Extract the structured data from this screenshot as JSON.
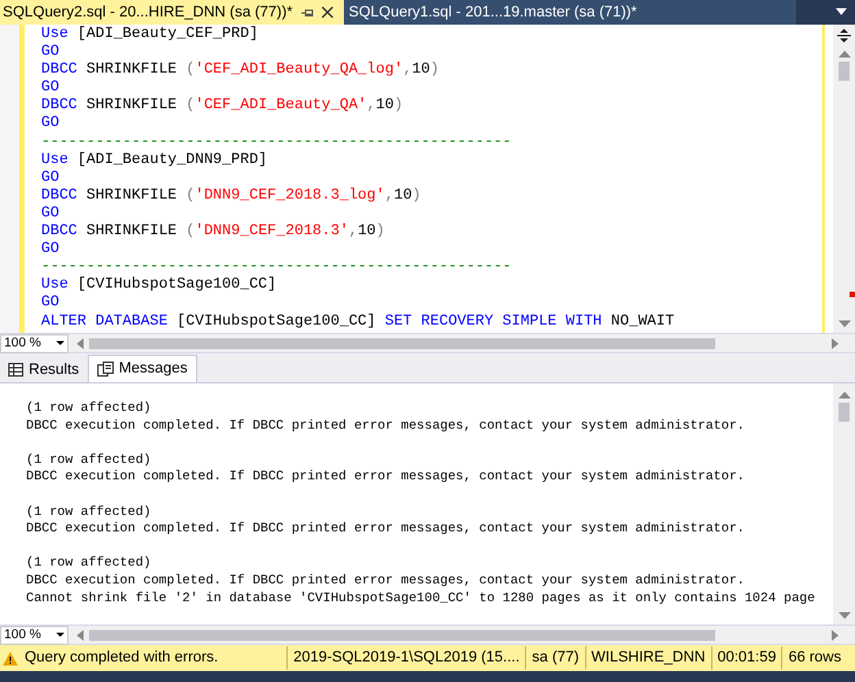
{
  "tabs": [
    {
      "label": "SQLQuery2.sql - 20...HIRE_DNN (sa (77))*",
      "selected": true
    },
    {
      "label": "SQLQuery1.sql - 201...19.master (sa (71))*",
      "selected": false
    }
  ],
  "editor": {
    "lines": [
      [
        {
          "kind": "keyword",
          "text": "Use"
        },
        {
          "kind": "plain",
          "text": " [ADI_Beauty_CEF_PRD]"
        }
      ],
      [
        {
          "kind": "keyword",
          "text": "GO"
        }
      ],
      [
        {
          "kind": "keyword",
          "text": "DBCC"
        },
        {
          "kind": "plain",
          "text": " SHRINKFILE "
        },
        {
          "kind": "punct",
          "text": "("
        },
        {
          "kind": "string",
          "text": "'CEF_ADI_Beauty_QA_log'"
        },
        {
          "kind": "punct",
          "text": ","
        },
        {
          "kind": "plain",
          "text": "10"
        },
        {
          "kind": "punct",
          "text": ")"
        }
      ],
      [
        {
          "kind": "keyword",
          "text": "GO"
        }
      ],
      [
        {
          "kind": "keyword",
          "text": "DBCC"
        },
        {
          "kind": "plain",
          "text": " SHRINKFILE "
        },
        {
          "kind": "punct",
          "text": "("
        },
        {
          "kind": "string",
          "text": "'CEF_ADI_Beauty_QA'"
        },
        {
          "kind": "punct",
          "text": ","
        },
        {
          "kind": "plain",
          "text": "10"
        },
        {
          "kind": "punct",
          "text": ")"
        }
      ],
      [
        {
          "kind": "keyword",
          "text": "GO"
        }
      ],
      [
        {
          "kind": "comment",
          "text": "----------------------------------------------------"
        }
      ],
      [
        {
          "kind": "keyword",
          "text": "Use"
        },
        {
          "kind": "plain",
          "text": " [ADI_Beauty_DNN9_PRD]"
        }
      ],
      [
        {
          "kind": "keyword",
          "text": "GO"
        }
      ],
      [
        {
          "kind": "keyword",
          "text": "DBCC"
        },
        {
          "kind": "plain",
          "text": " SHRINKFILE "
        },
        {
          "kind": "punct",
          "text": "("
        },
        {
          "kind": "string",
          "text": "'DNN9_CEF_2018.3_log'"
        },
        {
          "kind": "punct",
          "text": ","
        },
        {
          "kind": "plain",
          "text": "10"
        },
        {
          "kind": "punct",
          "text": ")"
        }
      ],
      [
        {
          "kind": "keyword",
          "text": "GO"
        }
      ],
      [
        {
          "kind": "keyword",
          "text": "DBCC"
        },
        {
          "kind": "plain",
          "text": " SHRINKFILE "
        },
        {
          "kind": "punct",
          "text": "("
        },
        {
          "kind": "string",
          "text": "'DNN9_CEF_2018.3'"
        },
        {
          "kind": "punct",
          "text": ","
        },
        {
          "kind": "plain",
          "text": "10"
        },
        {
          "kind": "punct",
          "text": ")"
        }
      ],
      [
        {
          "kind": "keyword",
          "text": "GO"
        }
      ],
      [
        {
          "kind": "comment",
          "text": "----------------------------------------------------"
        }
      ],
      [
        {
          "kind": "keyword",
          "text": "Use"
        },
        {
          "kind": "plain",
          "text": " [CVIHubspotSage100_CC]"
        }
      ],
      [
        {
          "kind": "keyword",
          "text": "GO"
        }
      ],
      [
        {
          "kind": "keyword",
          "text": "ALTER DATABASE"
        },
        {
          "kind": "plain",
          "text": " [CVIHubspotSage100_CC] "
        },
        {
          "kind": "keyword",
          "text": "SET RECOVERY SIMPLE WITH"
        },
        {
          "kind": "plain",
          "text": " NO_WAIT"
        }
      ]
    ],
    "zoom": "100 %"
  },
  "result_tabs": [
    {
      "label": "Results",
      "kind": "grid",
      "selected": false
    },
    {
      "label": "Messages",
      "kind": "messages",
      "selected": true
    }
  ],
  "messages": {
    "groups": [
      [
        "(1 row affected)",
        "DBCC execution completed. If DBCC printed error messages, contact your system administrator."
      ],
      [
        "(1 row affected)",
        "DBCC execution completed. If DBCC printed error messages, contact your system administrator."
      ],
      [
        "(1 row affected)",
        "DBCC execution completed. If DBCC printed error messages, contact your system administrator."
      ],
      [
        "(1 row affected)",
        "DBCC execution completed. If DBCC printed error messages, contact your system administrator.",
        "Cannot shrink file '2' in database 'CVIHubspotSage100_CC' to 1280 pages as it only contains 1024 page"
      ]
    ],
    "zoom": "100 %"
  },
  "status_bar": {
    "message": "Query completed with errors.",
    "fields": [
      "2019-SQL2019-1\\SQL2019 (15....",
      "sa (77)",
      "WILSHIRE_DNN",
      "00:01:59",
      "66 rows"
    ]
  }
}
